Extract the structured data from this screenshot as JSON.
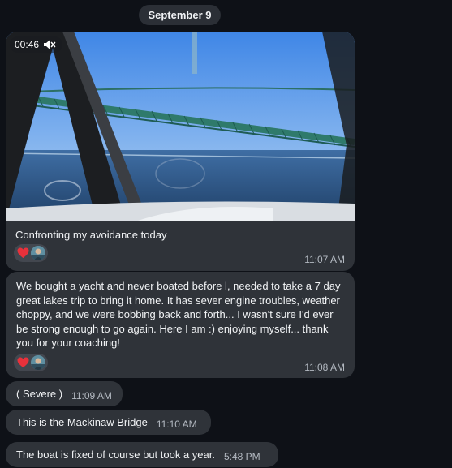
{
  "date_separator": "September 9",
  "messages": [
    {
      "type": "video",
      "duration": "00:46",
      "caption": "Confronting my avoidance today",
      "reactions": [
        "heart",
        "avatar"
      ],
      "time": "11:07 AM"
    },
    {
      "type": "text",
      "text": "We bought a yacht and never boated before l, needed to take a 7 day great lakes trip to bring it home. It has sever engine troubles, weather choppy, and we were bobbing back and forth... I wasn't sure I'd ever be strong enough to go again. Here I am :) enjoying myself... thank you for your coaching!",
      "reactions": [
        "heart",
        "avatar"
      ],
      "time": "11:08 AM"
    },
    {
      "type": "text",
      "text": "( Severe )",
      "time": "11:09 AM"
    },
    {
      "type": "text",
      "text": "This is the Mackinaw Bridge",
      "time": "11:10 AM"
    },
    {
      "type": "text",
      "text": "The boat is fixed of course but took a year.",
      "time": "5:48 PM"
    }
  ],
  "colors": {
    "background": "#0e1117",
    "bubble": "#2f3339",
    "reaction_pill": "#43474f",
    "heart": "#e8313b",
    "timestamp": "#b4bac2"
  },
  "icons": {
    "video_mute": "speaker-muted-icon",
    "reaction_heart": "red-heart-icon",
    "reaction_avatar": "user-avatar"
  }
}
